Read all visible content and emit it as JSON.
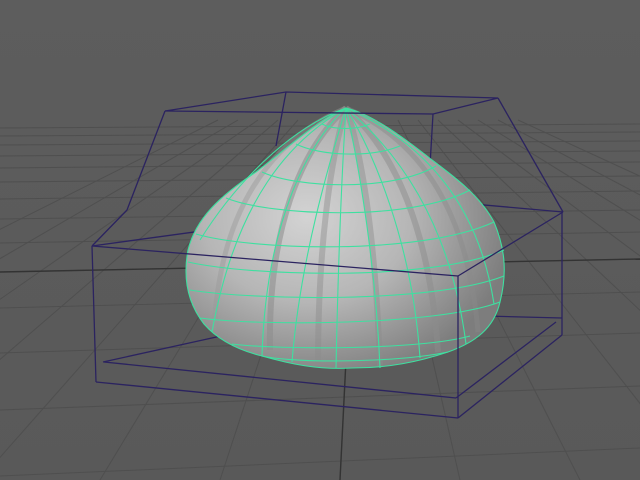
{
  "viewport": {
    "name": "perspective-viewport",
    "colors": {
      "background": "#5b5b5b",
      "grid_line": "#4e4e4e",
      "grid_line_light": "#666666",
      "bounding_box": "#2b2360",
      "mesh_fill": "#b9b9b9",
      "mesh_shadow": "#8a8a8a",
      "wireframe": "#3ee0a0"
    },
    "scene": {
      "object": "garlic-bulb-mesh",
      "selected": true,
      "display": "smooth-shaded-with-wireframe-on-shaded"
    }
  }
}
